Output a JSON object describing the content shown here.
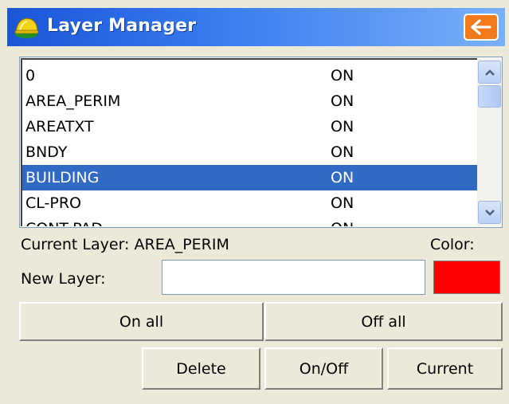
{
  "window": {
    "title": "Layer Manager",
    "back_icon": "arrow-left-icon",
    "app_icon": "hardhat-icon"
  },
  "layers": [
    {
      "name": "0",
      "state": "ON",
      "selected": false
    },
    {
      "name": "AREA_PERIM",
      "state": "ON",
      "selected": false
    },
    {
      "name": "AREATXT",
      "state": "ON",
      "selected": false
    },
    {
      "name": "BNDY",
      "state": "ON",
      "selected": false
    },
    {
      "name": "BUILDING",
      "state": "ON",
      "selected": true
    },
    {
      "name": "CL-PRO",
      "state": "ON",
      "selected": false
    },
    {
      "name": "CONT-PAD",
      "state": "ON",
      "selected": false
    }
  ],
  "current_layer": {
    "label": "Current Layer:",
    "value": "AREA_PERIM"
  },
  "color": {
    "label": "Color:",
    "value": "#ff0000"
  },
  "new_layer": {
    "label": "New Layer:",
    "value": ""
  },
  "buttons": {
    "on_all": "On all",
    "off_all": "Off all",
    "delete": "Delete",
    "on_off": "On/Off",
    "current": "Current"
  },
  "colors": {
    "title_gradient_start": "#1a55d8",
    "title_gradient_end": "#7ab0f8",
    "back_button": "#f07a1c",
    "selection": "#316ac5",
    "window_bg": "#ece9d8"
  }
}
